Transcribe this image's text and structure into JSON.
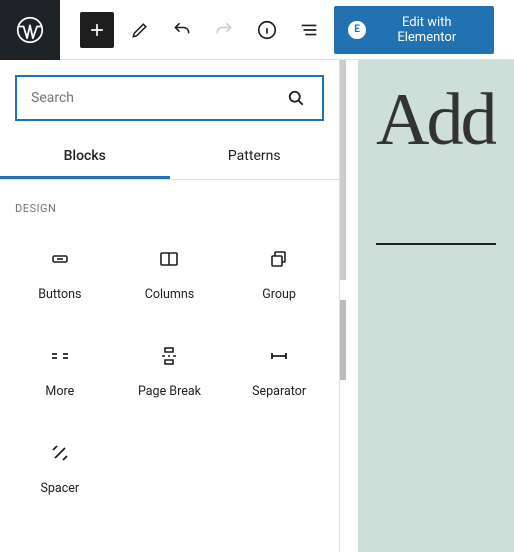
{
  "toolbar": {
    "elementor_label": "Edit with Elementor"
  },
  "search": {
    "placeholder": "Search"
  },
  "tabs": {
    "blocks": "Blocks",
    "patterns": "Patterns"
  },
  "category": "DESIGN",
  "blocks": {
    "buttons": "Buttons",
    "columns": "Columns",
    "group": "Group",
    "more": "More",
    "page_break": "Page Break",
    "separator": "Separator",
    "spacer": "Spacer"
  },
  "canvas": {
    "title": "Add"
  },
  "colors": {
    "accent": "#2271b1",
    "canvas_bg": "#cedfd9"
  }
}
